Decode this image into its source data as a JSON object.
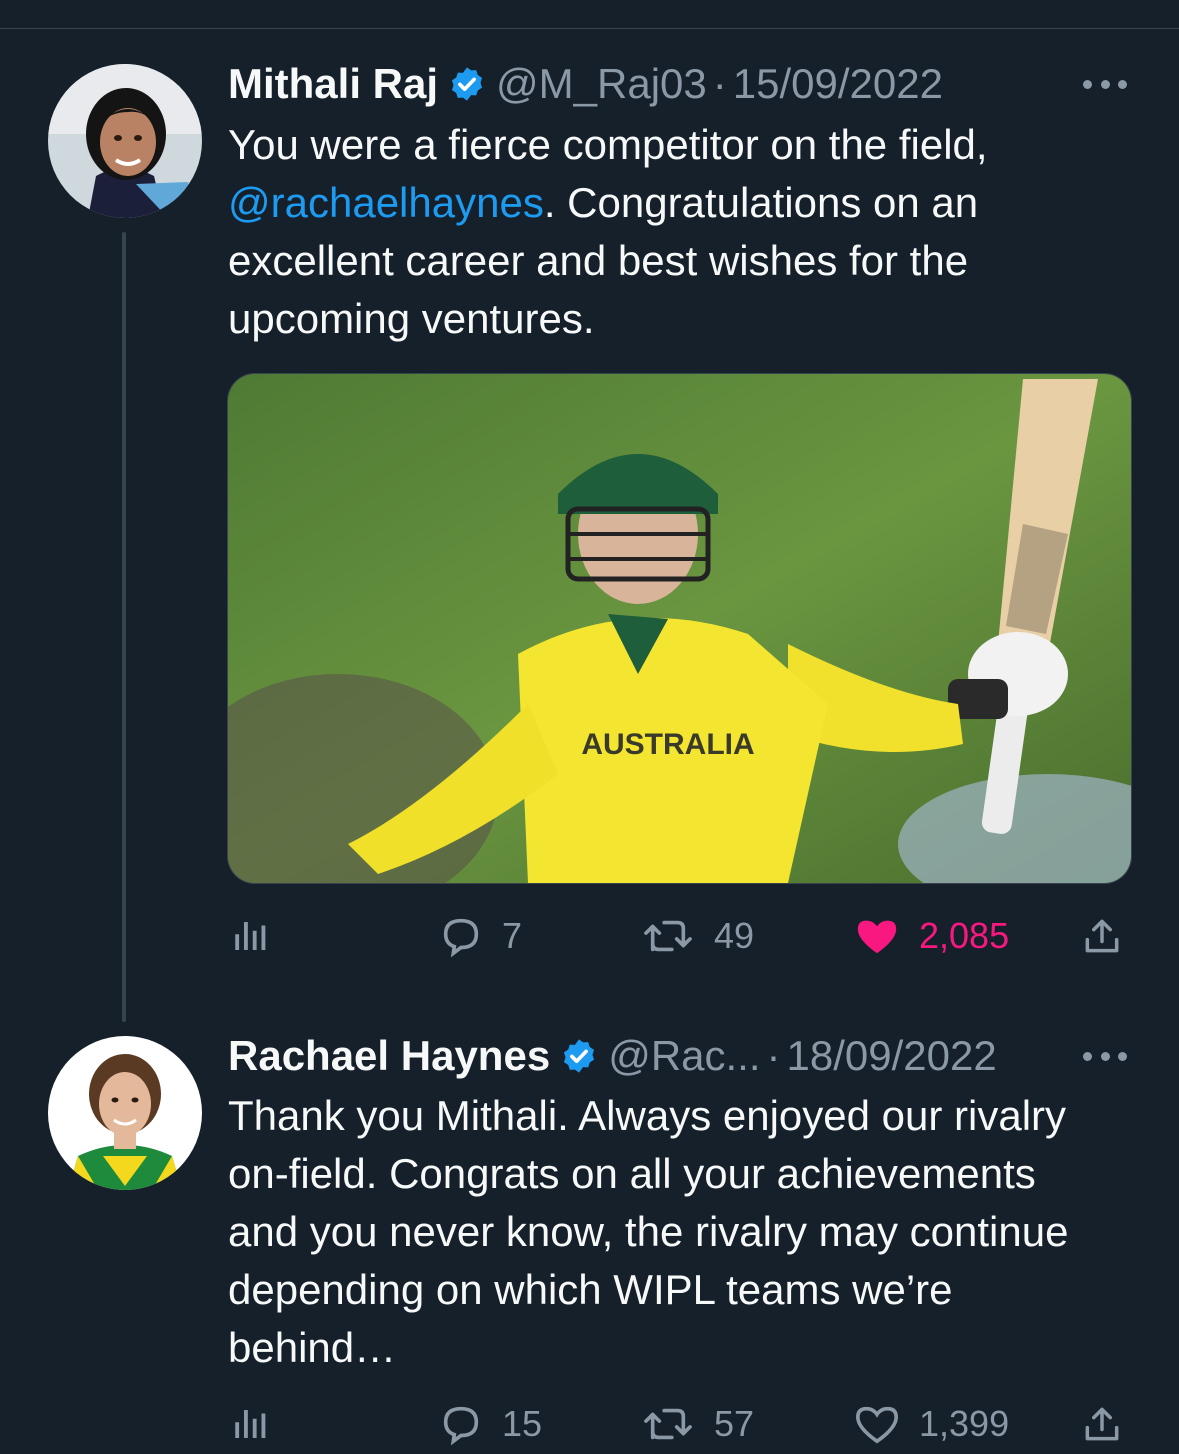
{
  "tweets": [
    {
      "name": "Mithali Raj",
      "handle": "@M_Raj03",
      "separator": "·",
      "date": "15/09/2022",
      "text_part1": "You were a fierce competitor on the field,",
      "mention": "@rachaelhaynes",
      "text_part2": ". Congratulations on an excellent career and best wishes for the upcoming ventures.",
      "image_jersey_text": "AUSTRALIA",
      "stats": {
        "replies": "7",
        "retweets": "49",
        "likes": "2,085"
      },
      "liked": true
    },
    {
      "name": "Rachael Haynes",
      "handle": "@Rac...",
      "separator": "·",
      "date": "18/09/2022",
      "text": "Thank you Mithali. Always enjoyed our rivalry on-field. Congrats on all your achievements and you never know, the rivalry may continue depending on which WIPL teams we’re behind…",
      "stats": {
        "replies": "15",
        "retweets": "57",
        "likes": "1,399"
      },
      "liked": false
    }
  ],
  "colors": {
    "background": "#15202b",
    "accent": "#1d9bf0",
    "like": "#f91880",
    "muted": "#8b98a5"
  },
  "icons": [
    "verified-badge-icon",
    "more-icon",
    "analytics-icon",
    "reply-icon",
    "retweet-icon",
    "heart-icon",
    "share-icon"
  ]
}
